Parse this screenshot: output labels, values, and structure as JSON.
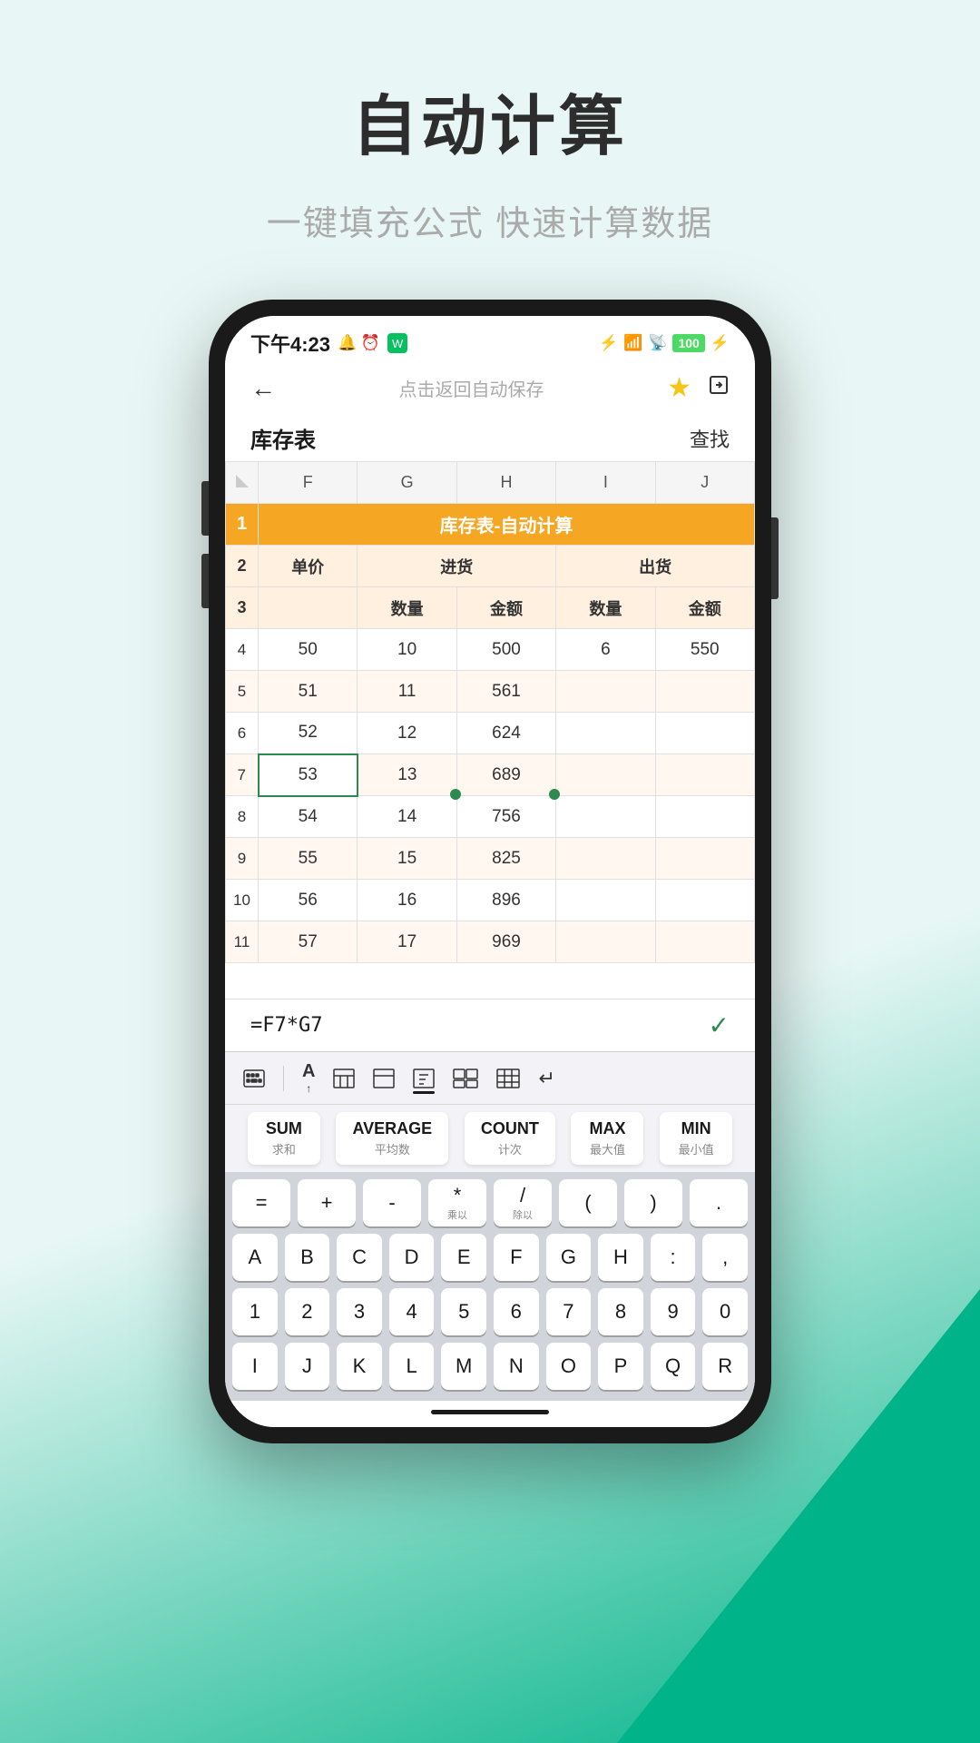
{
  "page": {
    "title": "自动计算",
    "subtitle": "一键填充公式 快速计算数据"
  },
  "statusBar": {
    "time": "下午4:23",
    "icons": "🔔 ⏰",
    "battery": "100",
    "signal": "●●●●"
  },
  "nav": {
    "backLabel": "←",
    "centerText": "点击返回自动保存",
    "findLabel": "查找"
  },
  "sheet": {
    "name": "库存表",
    "findLabel": "查找",
    "titleRow": "库存表-自动计算",
    "columns": [
      "F",
      "G",
      "H",
      "I",
      "J"
    ],
    "subheaders": {
      "F": "单价",
      "GH": "进货",
      "IJ": "出货",
      "G": "数量",
      "H": "金额",
      "I": "数量",
      "J": "金额"
    },
    "rows": [
      {
        "row": 4,
        "F": "50",
        "G": "10",
        "H": "500",
        "I": "6",
        "J": "550"
      },
      {
        "row": 5,
        "F": "51",
        "G": "11",
        "H": "561",
        "I": "",
        "J": ""
      },
      {
        "row": 6,
        "F": "52",
        "G": "12",
        "H": "624",
        "I": "",
        "J": ""
      },
      {
        "row": 7,
        "F": "53",
        "G": "13",
        "H": "689",
        "I": "",
        "J": "",
        "selected": true
      },
      {
        "row": 8,
        "F": "54",
        "G": "14",
        "H": "756",
        "I": "",
        "J": ""
      },
      {
        "row": 9,
        "F": "55",
        "G": "15",
        "H": "825",
        "I": "",
        "J": ""
      },
      {
        "row": 10,
        "F": "56",
        "G": "16",
        "H": "896",
        "I": "",
        "J": ""
      },
      {
        "row": 11,
        "F": "57",
        "G": "17",
        "H": "969",
        "I": "",
        "J": ""
      }
    ]
  },
  "formulaBar": {
    "formula": "=F7*G7",
    "checkIcon": "✓"
  },
  "toolbar": {
    "icons": [
      "⊟",
      "A↑",
      "⊞",
      "⊟",
      "⊠",
      "⊞⊞",
      "⊟⊟",
      "↵"
    ]
  },
  "functions": [
    {
      "main": "SUM",
      "sub": "求和"
    },
    {
      "main": "AVERAGE",
      "sub": "平均数"
    },
    {
      "main": "COUNT",
      "sub": "计次"
    },
    {
      "main": "MAX",
      "sub": "最大值"
    },
    {
      "main": "MIN",
      "sub": "最小值"
    }
  ],
  "keyboard": {
    "opRow": [
      "=",
      "+",
      "-",
      "*\n乘以",
      "/\n除以",
      "(",
      ")",
      "."
    ],
    "letterRow1": [
      "A",
      "B",
      "C",
      "D",
      "E",
      "F",
      "G",
      "H",
      ":",
      ","
    ],
    "numberRow": [
      "1",
      "2",
      "3",
      "4",
      "5",
      "6",
      "7",
      "8",
      "9",
      "0"
    ],
    "letterRow2": [
      "I",
      "J",
      "K",
      "L",
      "M",
      "N",
      "O",
      "P",
      "Q",
      "R"
    ]
  }
}
